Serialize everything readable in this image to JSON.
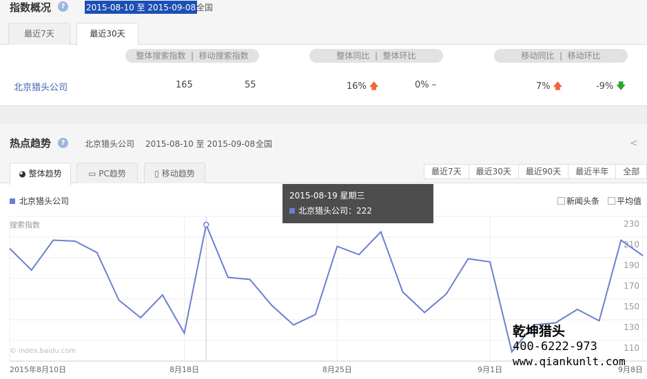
{
  "overview": {
    "title": "指数概况",
    "date_range": "2015-08-10 至 2015-09-08",
    "region": "全国",
    "tabs": [
      {
        "label": "最近7天"
      },
      {
        "label": "最近30天",
        "active": true
      }
    ],
    "headers": {
      "search": "整体搜索指数",
      "mobile_search": "移动搜索指数",
      "yoy": "整体同比",
      "mom": "整体环比",
      "m_yoy": "移动同比",
      "m_mom": "移动环比",
      "divider": "|"
    },
    "row": {
      "keyword": "北京猎头公司",
      "search": "165",
      "mobile_search": "55",
      "yoy": "16%",
      "yoy_trend": "up",
      "mom": "0%",
      "mom_trend": "flat",
      "m_yoy": "7%",
      "m_yoy_trend": "up",
      "m_mom": "-9%",
      "m_mom_trend": "down"
    }
  },
  "trend": {
    "title": "热点趋势",
    "keyword": "北京猎头公司",
    "date_range": "2015-08-10 至 2015-09-08",
    "region": "全国",
    "tabs": [
      {
        "label": "整体趋势",
        "active": true
      },
      {
        "label": "PC趋势"
      },
      {
        "label": "移动趋势"
      }
    ],
    "ranges": [
      "最近7天",
      "最近30天",
      "最近90天",
      "最近半年",
      "全部"
    ],
    "legend": "北京猎头公司",
    "options": [
      "新闻头条",
      "平均值"
    ],
    "tooltip": {
      "date": "2015-08-19 星期三",
      "label": "北京猎头公司：222"
    },
    "watermark": "© index.baidu.com"
  },
  "overlay": {
    "name": "乾坤猎头",
    "phone": "400-6222-973",
    "url": "www.qiankunlt.com"
  },
  "colors": {
    "series": "#6a7fcf",
    "up": "#f0673e",
    "down": "#2aa62a",
    "link": "#3b63b6"
  },
  "chart_data": {
    "type": "line",
    "ylabel": "搜索指数",
    "ylim": [
      90,
      230
    ],
    "yticks": [
      230,
      210,
      190,
      170,
      150,
      130,
      110
    ],
    "xtick_labels": [
      {
        "i": 0,
        "label": "2015年8月10日"
      },
      {
        "i": 8,
        "label": "8月18日"
      },
      {
        "i": 15,
        "label": "8月25日"
      },
      {
        "i": 22,
        "label": "9月1日"
      },
      {
        "i": 29,
        "label": "9月8日"
      }
    ],
    "x_start": "2015-08-10",
    "x_end": "2015-09-08",
    "highlight_index": 9,
    "series": [
      {
        "name": "北京猎头公司",
        "values": [
          199,
          178,
          207,
          206,
          195,
          149,
          132,
          154,
          117,
          222,
          171,
          169,
          144,
          125,
          135,
          201,
          193,
          215,
          157,
          137,
          155,
          189,
          186,
          99,
          125,
          127,
          140,
          129,
          207,
          192
        ]
      }
    ]
  }
}
